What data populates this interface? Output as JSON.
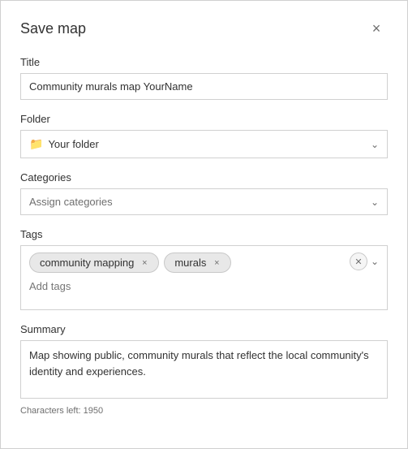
{
  "dialog": {
    "title": "Save map",
    "close_label": "×"
  },
  "fields": {
    "title": {
      "label": "Title",
      "value": "Community murals map YourName",
      "placeholder": ""
    },
    "folder": {
      "label": "Folder",
      "folder_icon": "🗂",
      "value": "Your folder",
      "chevron": "⌄"
    },
    "categories": {
      "label": "Categories",
      "placeholder": "Assign categories",
      "chevron": "⌄"
    },
    "tags": {
      "label": "Tags",
      "chips": [
        {
          "label": "community mapping",
          "remove": "×"
        },
        {
          "label": "murals",
          "remove": "×"
        }
      ],
      "add_placeholder": "Add tags",
      "clear_label": "×",
      "chevron": "⌄"
    },
    "summary": {
      "label": "Summary",
      "value": "Map showing public, community murals that reflect the local community's identity and experiences.",
      "chars_left_label": "Characters left: 1950"
    }
  }
}
